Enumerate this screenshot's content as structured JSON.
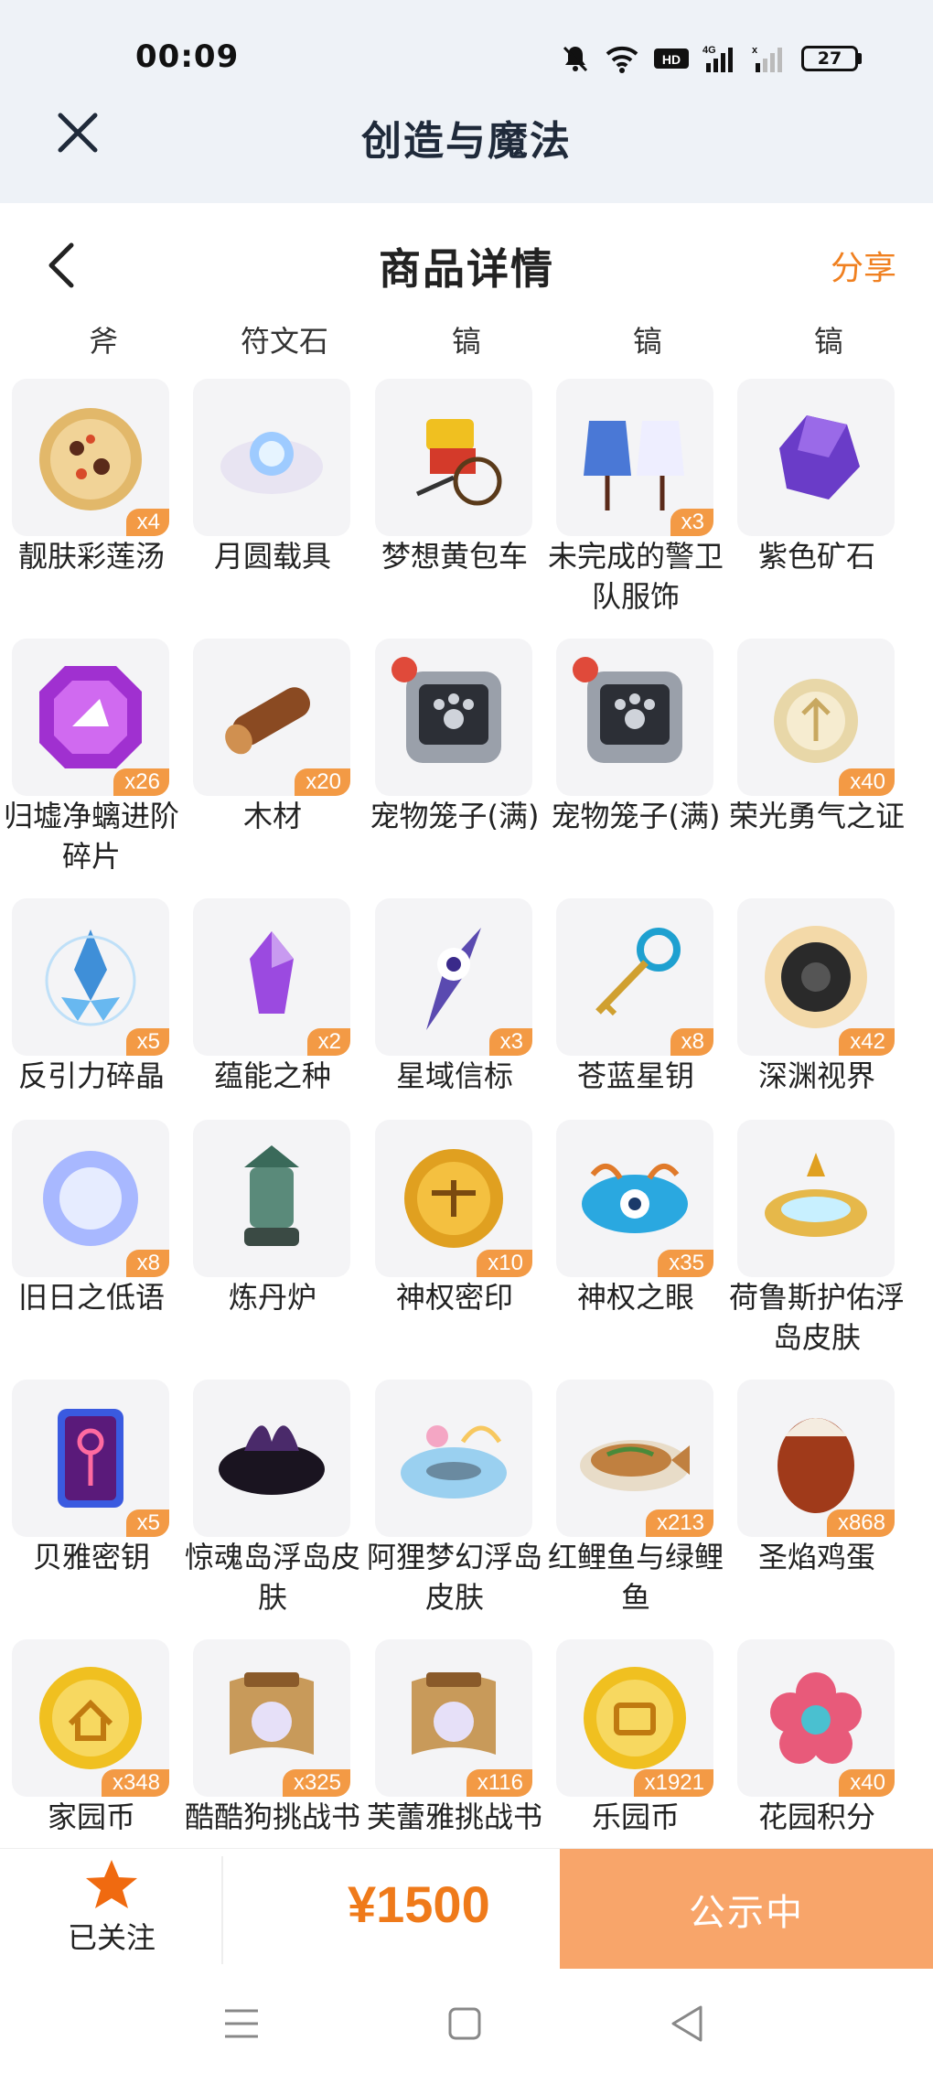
{
  "status_bar": {
    "time": "00:09",
    "battery": "27"
  },
  "app_header": {
    "title": "创造与魔法"
  },
  "page": {
    "title": "商品详情",
    "share": "分享"
  },
  "column_headers": [
    "斧",
    "符文石",
    "镐",
    "镐",
    "镐"
  ],
  "items": [
    {
      "name": "靓肤彩莲汤",
      "count": "x4",
      "icon": "soup-icon",
      "color": "#e2b86a"
    },
    {
      "name": "月圆载具",
      "count": "",
      "icon": "moon-cloud-icon",
      "color": "#9ecbff"
    },
    {
      "name": "梦想黄包车",
      "count": "",
      "icon": "rickshaw-icon",
      "color": "#d43a2a"
    },
    {
      "name": "未完成的警卫队服饰",
      "count": "x3",
      "icon": "uniform-icon",
      "color": "#4a78d6"
    },
    {
      "name": "紫色矿石",
      "count": "",
      "icon": "purple-ore-icon",
      "color": "#6a3cc8"
    },
    {
      "name": "归墟净螭进阶碎片",
      "count": "x26",
      "icon": "purple-gem-icon",
      "color": "#a030d0"
    },
    {
      "name": "木材",
      "count": "x20",
      "icon": "wood-log-icon",
      "color": "#8a4a22"
    },
    {
      "name": "宠物笼子(满)",
      "count": "",
      "icon": "pet-cage-icon",
      "color": "#6b7280"
    },
    {
      "name": "宠物笼子(满)",
      "count": "",
      "icon": "pet-cage-icon",
      "color": "#6b7280"
    },
    {
      "name": "荣光勇气之证",
      "count": "x40",
      "icon": "glory-badge-icon",
      "color": "#e8d7a8"
    },
    {
      "name": "反引力碎晶",
      "count": "x5",
      "icon": "antigravity-crystal-icon",
      "color": "#3f8fd8"
    },
    {
      "name": "蕴能之种",
      "count": "x2",
      "icon": "energy-seed-icon",
      "color": "#9b4ae0"
    },
    {
      "name": "星域信标",
      "count": "x3",
      "icon": "star-beacon-icon",
      "color": "#5a4ab0"
    },
    {
      "name": "苍蓝星钥",
      "count": "x8",
      "icon": "blue-star-key-icon",
      "color": "#1ea0d0"
    },
    {
      "name": "深渊视界",
      "count": "x42",
      "icon": "abyss-eye-icon",
      "color": "#2a2a2a"
    },
    {
      "name": "旧日之低语",
      "count": "x8",
      "icon": "whisper-orb-icon",
      "color": "#a8b8ff"
    },
    {
      "name": "炼丹炉",
      "count": "",
      "icon": "alchemy-furnace-icon",
      "color": "#3a6a5a"
    },
    {
      "name": "神权密印",
      "count": "x10",
      "icon": "divine-seal-coin-icon",
      "color": "#e0a020"
    },
    {
      "name": "神权之眼",
      "count": "x35",
      "icon": "divine-eye-icon",
      "color": "#2aa8e0"
    },
    {
      "name": "荷鲁斯护佑浮岛皮肤",
      "count": "",
      "icon": "horus-island-icon",
      "color": "#e6b84a"
    },
    {
      "name": "贝雅密钥",
      "count": "x5",
      "icon": "beya-key-card-icon",
      "color": "#3a5ae0"
    },
    {
      "name": "惊魂岛浮岛皮肤",
      "count": "",
      "icon": "haunted-island-icon",
      "color": "#4a2a6a"
    },
    {
      "name": "阿狸梦幻浮岛皮肤",
      "count": "",
      "icon": "ali-dream-island-icon",
      "color": "#9ad0f0"
    },
    {
      "name": "红鲤鱼与绿鲤鱼",
      "count": "x213",
      "icon": "carp-dish-icon",
      "color": "#c08040"
    },
    {
      "name": "圣焰鸡蛋",
      "count": "x868",
      "icon": "holy-flame-egg-icon",
      "color": "#a03a1a"
    },
    {
      "name": "家园币",
      "count": "x348",
      "icon": "home-coin-icon",
      "color": "#f0c020"
    },
    {
      "name": "酷酷狗挑战书",
      "count": "x325",
      "icon": "wanted-scroll-icon",
      "color": "#c89a5a"
    },
    {
      "name": "芙蕾雅挑战书",
      "count": "x116",
      "icon": "wanted-scroll-icon",
      "color": "#c89a5a"
    },
    {
      "name": "乐园币",
      "count": "x1921",
      "icon": "park-coin-icon",
      "color": "#f0c020"
    },
    {
      "name": "花园积分",
      "count": "x40",
      "icon": "garden-flower-icon",
      "color": "#e85a7a"
    }
  ],
  "bottom_bar": {
    "follow_label": "已关注",
    "price": "¥1500",
    "status_button": "公示中"
  }
}
